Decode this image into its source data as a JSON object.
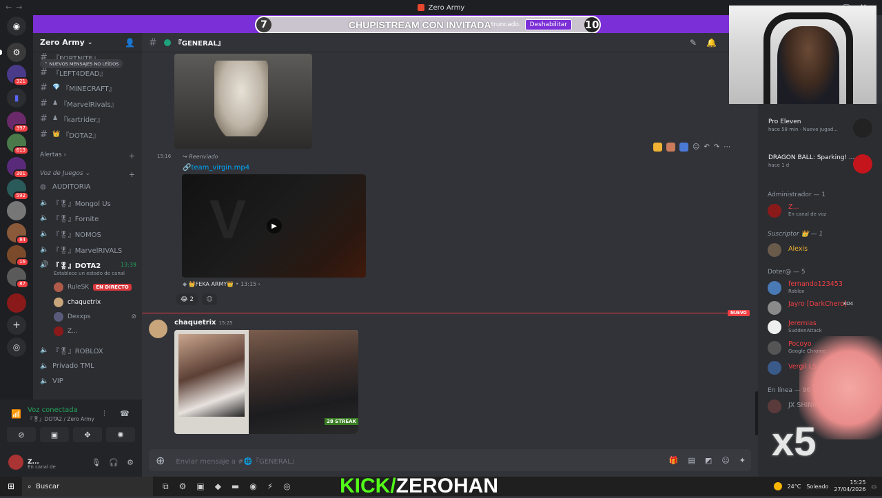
{
  "titlebar": {
    "app_title": "Zero Army"
  },
  "banner": {
    "left_num": "7",
    "right_num": "10",
    "title": "CHUPISTREAM CON INVITADA",
    "truncated": "truncado.",
    "disable_label": "Deshabilitar"
  },
  "guilds": [
    {
      "badge": "321"
    },
    {
      "badge": "397"
    },
    {
      "badge": "613"
    },
    {
      "badge": "301"
    },
    {
      "badge": "592"
    },
    {
      "badge": "84"
    },
    {
      "badge": "16"
    },
    {
      "badge": "87"
    }
  ],
  "server": {
    "name": "Zero Army"
  },
  "unread_label": "NUEVOS MENSAJES NO LEÍDOS",
  "text_channels": [
    {
      "name": "『FORTNITE』"
    },
    {
      "name": "『LEFT4DEAD』"
    },
    {
      "name": "『MINECRAFT』"
    },
    {
      "name": "『MarvelRivals』"
    },
    {
      "name": "『kartrider』"
    },
    {
      "name": "『DOTA2』"
    }
  ],
  "categories": {
    "alerts": "Alertas",
    "voice": "Voz de Juegos"
  },
  "voice_channels": [
    {
      "name": "AUDITORIA"
    },
    {
      "name": "『🎖』Mongol Us"
    },
    {
      "name": "『🎖』Fornite"
    },
    {
      "name": "『🎖』NOMOS"
    },
    {
      "name": "『🎖』MarvelRIVALS"
    },
    {
      "name": "『🎖』DOTA2",
      "time": "13:39"
    },
    {
      "name": "『🎖』ROBLOX"
    },
    {
      "name": "Privado TML"
    },
    {
      "name": "VIP"
    }
  ],
  "voice_status_hint": "Establece un estado de canal",
  "voice_members": [
    {
      "name": "RuleSK",
      "live": "EN DIRECTO"
    },
    {
      "name": "chaquetrix"
    },
    {
      "name": "Dexxps"
    },
    {
      "name": "Z..."
    }
  ],
  "voice_connected": {
    "title": "Voz conectada",
    "sub": "『🎖』DOTA2 / Zero Army"
  },
  "user": {
    "name": "Z...",
    "status": "En canal de"
  },
  "channel": {
    "name": "『GENERAL』"
  },
  "messages": {
    "time1": "15:16",
    "forwarded": "Reenviado",
    "file": "team_virgin.mp4",
    "fwd_source": "👑FEKA ARMY👑",
    "fwd_time": "13:15",
    "reaction_count": "2",
    "new_tag": "NUEVO",
    "author": "chaquetrix",
    "author_time": "15:25",
    "streak": "28 STREAK"
  },
  "composer": {
    "placeholder": "Enviar mensaje a #🌐『GENERAL』"
  },
  "members": {
    "activity1": {
      "name": "Pro Eleven",
      "time": "hace 58 min",
      "sub": "Nuevo jugad..."
    },
    "activity2": {
      "name": "DRAGON BALL: Sparking! ...",
      "time": "hace 1 d"
    },
    "role_admin": "Administrador — 1",
    "admin_member": {
      "name": "Z...",
      "activity": "En canal de voz"
    },
    "role_sub": "Suscriptor 👑 — 1",
    "sub_member": {
      "name": "Alexis"
    },
    "role_doter": "Doter@ — 5",
    "doters": [
      {
        "name": "fernando123453",
        "activity": "Roblox"
      },
      {
        "name": "Jayro [DarkChero]",
        "activity": "KO4"
      },
      {
        "name": "Jeremias",
        "activity": "SuddenAttack"
      },
      {
        "name": "Pocoyo",
        "activity": "Google Chrome"
      },
      {
        "name": "Vergil LS",
        "activity": ""
      }
    ],
    "role_online": "En línea — 96",
    "online_first": "JX SHINIGAMI"
  },
  "overlay": {
    "kick_prefix": "KICK/",
    "kick_name": "ZEROHAN",
    "multiplier": "x5"
  },
  "taskbar": {
    "search": "Buscar",
    "temp": "24°C",
    "weather": "Soleado",
    "clock": "15:25",
    "date": "27/04/2026"
  },
  "colors": {
    "blurple": "#5865f2",
    "kick_green": "#53fc18",
    "danger": "#f23f43",
    "online": "#23a55a"
  }
}
